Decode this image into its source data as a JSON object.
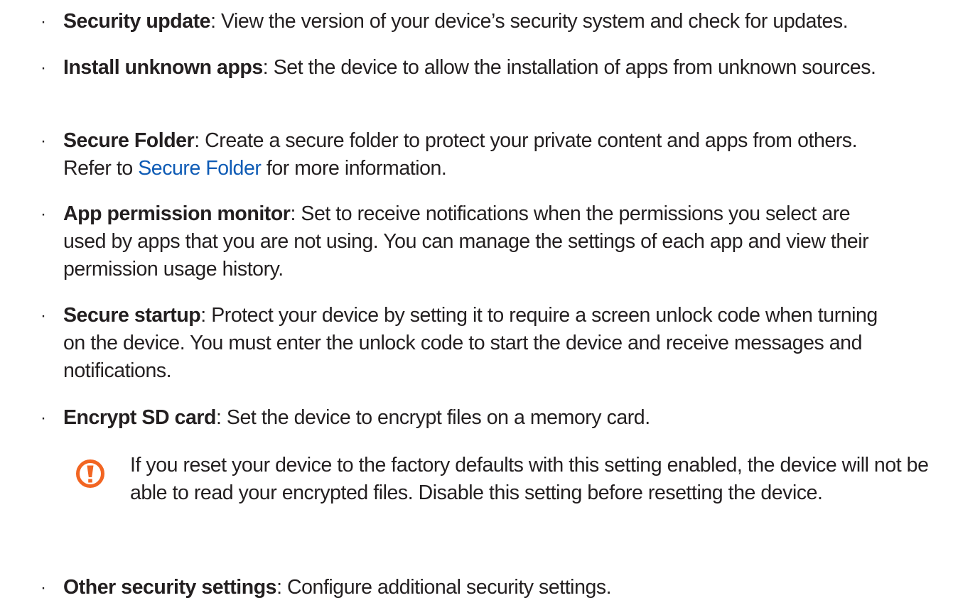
{
  "items": [
    {
      "bullet": "·",
      "term": "Security update",
      "desc": ": View the version of your device’s security system and check for updates."
    },
    {
      "bullet": "·",
      "term": "Install unknown apps",
      "desc": ": Set the device to allow the installation of apps from unknown sources."
    },
    {
      "bullet": "·",
      "term": "Secure Folder",
      "desc_before": ": Create a secure folder to protect your private content and apps from others. Refer to ",
      "link": "Secure Folder",
      "desc_after": " for more information."
    },
    {
      "bullet": "·",
      "term": "App permission monitor",
      "desc": ": Set to receive notifications when the permissions you select are used by apps that you are not using. You can manage the settings of each app and view their permission usage history."
    },
    {
      "bullet": "·",
      "term": "Secure startup",
      "desc": ": Protect your device by setting it to require a screen unlock code when turning on the device. You must enter the unlock code to start the device and receive messages and notifications."
    },
    {
      "bullet": "·",
      "term": "Encrypt SD card",
      "desc": ": Set the device to encrypt files on a memory card."
    },
    {
      "bullet": "·",
      "term": "Other security settings",
      "desc": ": Configure additional security settings."
    }
  ],
  "note": {
    "icon": "caution-icon",
    "icon_color": "#f26522",
    "text": "If you reset your device to the factory defaults with this setting enabled, the device will not be able to read your encrypted files. Disable this setting before resetting the device."
  },
  "link_color": "#0e5bb5"
}
